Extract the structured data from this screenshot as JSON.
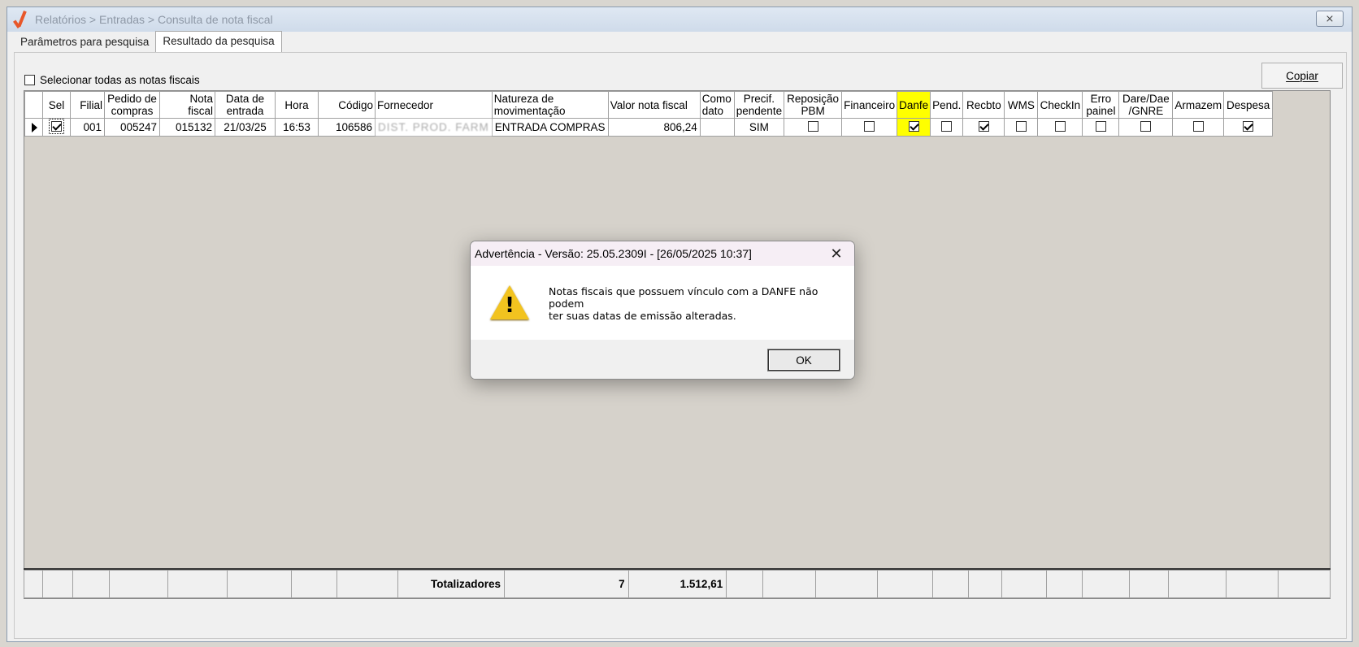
{
  "window": {
    "title": "Relatórios > Entradas > Consulta de nota fiscal",
    "close_glyph": "⨯"
  },
  "tabs": [
    {
      "label": "Parâmetros para pesquisa",
      "active": false
    },
    {
      "label": "Resultado da pesquisa",
      "active": true
    }
  ],
  "select_all_label": "Selecionar todas as notas fiscais",
  "copy_button": "Copiar",
  "grid": {
    "headers": {
      "sel": "Sel",
      "filial": "Filial",
      "pedido_1": "Pedido de",
      "pedido_2": "compras",
      "nota": "Nota fiscal",
      "data_1": "Data de",
      "data_2": "entrada",
      "hora": "Hora",
      "codigo": "Código",
      "fornecedor": "Fornecedor",
      "natureza_1": "Natureza de",
      "natureza_2": "movimentação",
      "valor": "Valor nota fiscal",
      "como_1": "Como",
      "como_2": "dato",
      "precif_1": "Precif.",
      "precif_2": "pendente",
      "repos_1": "Reposição",
      "repos_2": "PBM",
      "financeiro": "Financeiro",
      "danfe": "Danfe",
      "pend": "Pend.",
      "recbto": "Recbto",
      "wms": "WMS",
      "checkin": "CheckIn",
      "erro_1": "Erro",
      "erro_2": "painel",
      "dare_1": "Dare/Dae",
      "dare_2": "/GNRE",
      "armazem": "Armazem",
      "despesa": "Despesa"
    },
    "row": {
      "sel": true,
      "filial": "001",
      "pedido": "005247",
      "nota": "015132",
      "data": "21/03/25",
      "hora": "16:53",
      "codigo": "106586",
      "fornecedor": "DIST. PROD. FARM",
      "natureza": "ENTRADA COMPRAS",
      "valor": "806,24",
      "como_dato": "",
      "precif": "SIM",
      "reposicao": false,
      "financeiro": false,
      "danfe": true,
      "pend": false,
      "recbto": true,
      "wms": false,
      "checkin": false,
      "erro": false,
      "dare": false,
      "armazem": false,
      "despesa": true
    },
    "totals": {
      "label": "Totalizadores",
      "count": "7",
      "sum": "1.512,61"
    }
  },
  "dialog": {
    "title": "Advertência - Versão: 25.05.2309I - [26/05/2025 10:37]",
    "message_1": "Notas fiscais que possuem vínculo com a DANFE não podem",
    "message_2": "ter suas datas de emissão alteradas.",
    "ok": "OK",
    "warn_glyph": "!",
    "close_glyph": "✕"
  },
  "colors": {
    "highlight": "#ffff00",
    "accent_logo": "#e8572a",
    "grid_bg": "#d6d2cb"
  }
}
